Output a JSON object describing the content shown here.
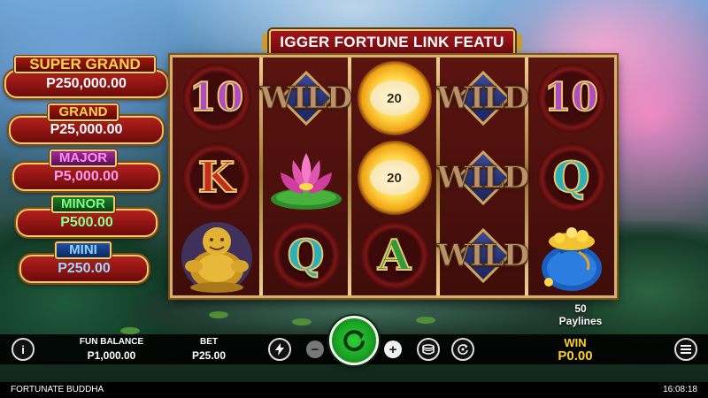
{
  "game": {
    "banner_text": "IGGER FORTUNE LINK FEATU",
    "title": "FORTUNATE BUDDHA",
    "clock": "16:08:18"
  },
  "jackpots": [
    {
      "label": "SUPER GRAND",
      "value": "P250,000.00",
      "tier": "super"
    },
    {
      "label": "GRAND",
      "value": "P25,000.00",
      "tier": "grand"
    },
    {
      "label": "MAJOR",
      "value": "P5,000.00",
      "tier": "major"
    },
    {
      "label": "MINOR",
      "value": "P500.00",
      "tier": "minor"
    },
    {
      "label": "MINI",
      "value": "P250.00",
      "tier": "mini"
    }
  ],
  "reels": [
    [
      "10",
      "K",
      "buddha"
    ],
    [
      "WILD",
      "lotus",
      "Q"
    ],
    [
      "20",
      "20",
      "A"
    ],
    [
      "WILD",
      "WILD",
      "WILD"
    ],
    [
      "10",
      "Q",
      "money-bag"
    ]
  ],
  "coin_values": [
    "20",
    "20"
  ],
  "paylines": {
    "count": "50",
    "label": "Paylines"
  },
  "controls": {
    "info_label": "i",
    "balance_label": "FUN BALANCE",
    "balance_value": "P1,000.00",
    "bet_label": "BET",
    "bet_value": "P25.00",
    "minus": "−",
    "plus": "+",
    "win_label": "WIN",
    "win_value": "P0.00"
  },
  "colors": {
    "spin_button": "#1aa424",
    "win_text": "#ffd21a",
    "frame_gold": "#d8b06a",
    "reel_bg": "#4a0f0c"
  }
}
